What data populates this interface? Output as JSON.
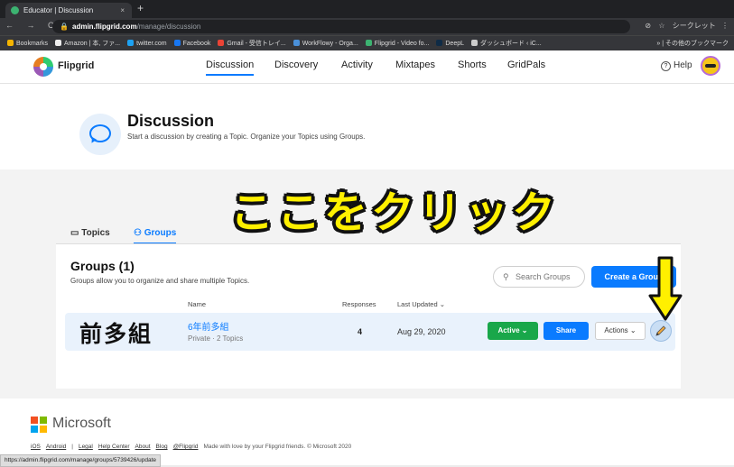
{
  "browser": {
    "tab_title": "Educator | Discussion",
    "tab_close": "×",
    "new_tab": "+",
    "nav_buttons": "← → C",
    "url_host": "admin.flipgrid.com",
    "url_path": "/manage/discussion",
    "incognito_label": "シークレット",
    "bookmarks": [
      {
        "label": "Bookmarks",
        "color": "#f4b400"
      },
      {
        "label": "Amazon | 本, ファ...",
        "color": "#eeeeee"
      },
      {
        "label": "twitter.com",
        "color": "#1da1f2"
      },
      {
        "label": "Facebook",
        "color": "#1877f2"
      },
      {
        "label": "Gmail - 受信トレイ...",
        "color": "#ea4335"
      },
      {
        "label": "WorkFlowy - Orga...",
        "color": "#4a90d9"
      },
      {
        "label": "Flipgrid - Video fo...",
        "color": "#3cb371"
      },
      {
        "label": "DeepL",
        "color": "#0f2b46"
      },
      {
        "label": "ダッシュボード ‹ iC...",
        "color": "#cccccc"
      }
    ],
    "bookmarks_right": "» | その他のブックマーク"
  },
  "nav": {
    "brand": "Flipgrid",
    "links": [
      "Discussion",
      "Discovery",
      "Activity",
      "Mixtapes",
      "Shorts",
      "GridPals"
    ],
    "help": "Help"
  },
  "hero": {
    "title": "Discussion",
    "subtitle": "Start a discussion by creating a Topic. Organize your Topics using Groups."
  },
  "overlay_caption": "ここをクリック",
  "tabs": {
    "topics": "Topics",
    "groups": "Groups"
  },
  "groups": {
    "title": "Groups (1)",
    "subtitle": "Groups allow you to organize and share multiple Topics.",
    "search_placeholder": "Search Groups",
    "create_button": "Create a Group",
    "columns": {
      "name": "Name",
      "responses": "Responses",
      "last_updated": "Last Updated ⌄"
    },
    "rows": [
      {
        "overlay_label": "前多組",
        "name": "6年前多組",
        "meta": "Private · 2 Topics",
        "responses": "4",
        "last_updated": "Aug 29, 2020",
        "status": "Active ⌄",
        "share": "Share",
        "actions": "Actions ⌄"
      }
    ]
  },
  "footer": {
    "company": "Microsoft",
    "links": [
      "iOS",
      "Android",
      "Legal",
      "Help Center",
      "About",
      "Blog",
      "@Flipgrid"
    ],
    "separator": "|",
    "note": "Made with love by your Flipgrid friends. © Microsoft 2020"
  },
  "status_url": "https://admin.flipgrid.com/manage/groups/5739426/update",
  "colors": {
    "accent": "#0a7bff",
    "active_green": "#19a74a",
    "overlay_yellow": "#fff000"
  }
}
